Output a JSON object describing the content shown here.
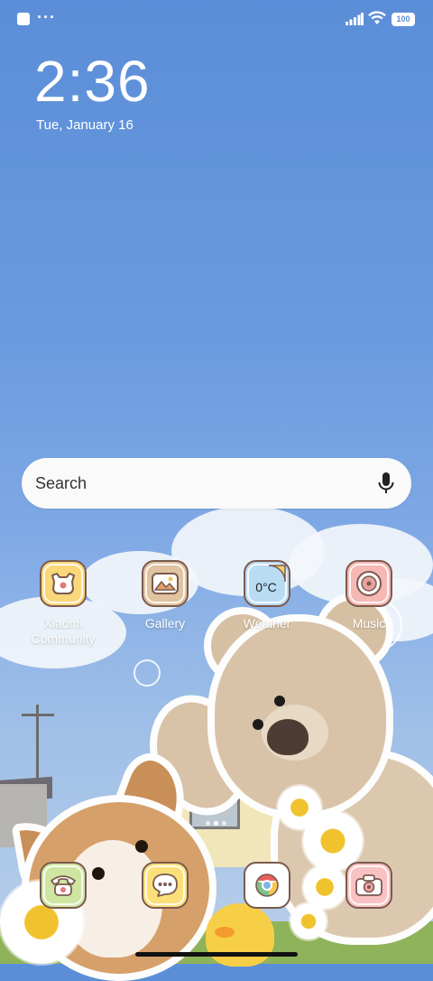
{
  "status_bar": {
    "notification_icon": "square-notification-icon",
    "more_indicator": "···",
    "battery_level": "100"
  },
  "lock_clock": {
    "time": "2:36",
    "date": "Tue, January 16"
  },
  "search": {
    "placeholder": "Search"
  },
  "apps_row": [
    {
      "label": "Xiaomi\nCommunity",
      "icon": "xiaomi-community-icon",
      "color": "#f9d77a"
    },
    {
      "label": "Gallery",
      "icon": "gallery-icon",
      "color": "#e0c3a0"
    },
    {
      "label": "Weather",
      "icon": "weather-icon",
      "color": "#b9dcf3",
      "temp": "0°C"
    },
    {
      "label": "Music",
      "icon": "music-icon",
      "color": "#f6b8b5"
    }
  ],
  "dock": [
    {
      "icon": "phone-icon",
      "color": "#cfe6a2"
    },
    {
      "icon": "messages-icon",
      "color": "#fbe07a"
    },
    {
      "icon": "chrome-icon",
      "color": "#ffffff"
    },
    {
      "icon": "camera-icon",
      "color": "#f9c2c2"
    }
  ]
}
